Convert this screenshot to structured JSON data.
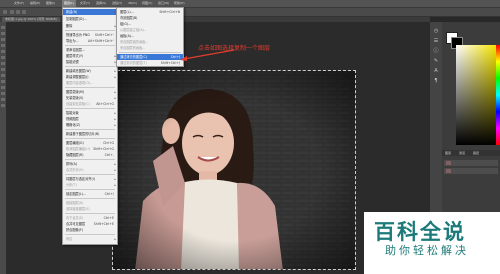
{
  "menubar": {
    "items": [
      "文件(F)",
      "编辑(E)",
      "图像(I)",
      "图层(L)",
      "文字(Y)",
      "选择(S)",
      "滤镜(T)",
      "3D(D)",
      "视图(V)",
      "窗口(W)",
      "帮助(H)"
    ],
    "active_index": 3
  },
  "tab": {
    "label": "未标题-1.jpg @ 100% (背景, RGB/8)"
  },
  "layer_menu": {
    "items": [
      {
        "label": "新建(N)",
        "shortcut": "",
        "submenu": true,
        "highlighted": true
      },
      {
        "label": "复制图层(D)...",
        "shortcut": "",
        "submenu": false
      },
      {
        "label": "删除",
        "shortcut": "",
        "submenu": true
      },
      {
        "label": "快速导出为 PNG",
        "shortcut": "Shift+Ctrl+'",
        "submenu": false
      },
      {
        "label": "导出为...",
        "shortcut": "Alt+Shift+Ctrl+'",
        "submenu": false
      },
      {
        "label": "重命名图层...",
        "shortcut": "",
        "submenu": false
      },
      {
        "label": "图层样式(Y)",
        "shortcut": "",
        "submenu": true
      },
      {
        "label": "智能滤镜",
        "shortcut": "",
        "submenu": true
      },
      {
        "label": "新建填充图层(W)",
        "shortcut": "",
        "submenu": true
      },
      {
        "label": "新建调整图层(J)",
        "shortcut": "",
        "submenu": true
      },
      {
        "label": "图层内容选项(O)...",
        "shortcut": "",
        "submenu": false
      },
      {
        "label": "图层蒙版(M)",
        "shortcut": "",
        "submenu": true
      },
      {
        "label": "矢量蒙版(V)",
        "shortcut": "",
        "submenu": true
      },
      {
        "label": "创建剪贴蒙版(C)",
        "shortcut": "Alt+Ctrl+G",
        "submenu": false
      },
      {
        "label": "智能对象",
        "shortcut": "",
        "submenu": true
      },
      {
        "label": "视频图层",
        "shortcut": "",
        "submenu": true
      },
      {
        "label": "栅格化(Z)",
        "shortcut": "",
        "submenu": true
      },
      {
        "label": "新建基于图层的切片(B)",
        "shortcut": "",
        "submenu": false
      },
      {
        "label": "图层编组(G)",
        "shortcut": "Ctrl+G",
        "submenu": false
      },
      {
        "label": "取消图层编组(U)",
        "shortcut": "Shift+Ctrl+G",
        "submenu": false
      },
      {
        "label": "隐藏图层(R)",
        "shortcut": "Ctrl+,",
        "submenu": false
      },
      {
        "label": "排列(A)",
        "shortcut": "",
        "submenu": true
      },
      {
        "label": "合并形状(H)",
        "shortcut": "",
        "submenu": true
      },
      {
        "label": "将图层与选区对齐(I)",
        "shortcut": "",
        "submenu": true
      },
      {
        "label": "分布(T)",
        "shortcut": "",
        "submenu": true
      },
      {
        "label": "锁定图层(L)...",
        "shortcut": "Ctrl+/",
        "submenu": false
      },
      {
        "label": "链接图层(K)",
        "shortcut": "",
        "submenu": false
      },
      {
        "label": "选择链接图层(S)",
        "shortcut": "",
        "submenu": false
      },
      {
        "label": "向下合并(E)",
        "shortcut": "Ctrl+E",
        "submenu": false
      },
      {
        "label": "合并可见图层",
        "shortcut": "Shift+Ctrl+E",
        "submenu": false
      },
      {
        "label": "拼合图像(F)",
        "shortcut": "",
        "submenu": false
      },
      {
        "label": "修边",
        "shortcut": "",
        "submenu": true
      }
    ]
  },
  "new_submenu": {
    "items": [
      {
        "label": "图层(L)...",
        "shortcut": "Shift+Ctrl+N"
      },
      {
        "label": "背景图层(B)",
        "shortcut": ""
      },
      {
        "label": "组(G)...",
        "shortcut": ""
      },
      {
        "label": "从图层建立组(A)...",
        "shortcut": ""
      },
      {
        "label": "画板(A)...",
        "shortcut": ""
      },
      {
        "label": "来自图层组的画板...",
        "shortcut": ""
      },
      {
        "label": "来自图层的画板...",
        "shortcut": ""
      },
      {
        "label": "通过拷贝的图层(C)",
        "shortcut": "Ctrl+J",
        "highlighted": true
      },
      {
        "label": "通过剪切的图层(T)",
        "shortcut": "Shift+Ctrl+J"
      }
    ]
  },
  "annotation": {
    "text": "点击如图选择复制一个图层"
  },
  "watermark": {
    "title": "百科全说",
    "subtitle": "助你轻松解决"
  },
  "panel": {
    "tabs": [
      "图层",
      "通道",
      "路径"
    ]
  },
  "colors": {
    "highlight": "#3a78d8",
    "annotation": "#e23c2e",
    "watermark": "#1d7a7a"
  }
}
